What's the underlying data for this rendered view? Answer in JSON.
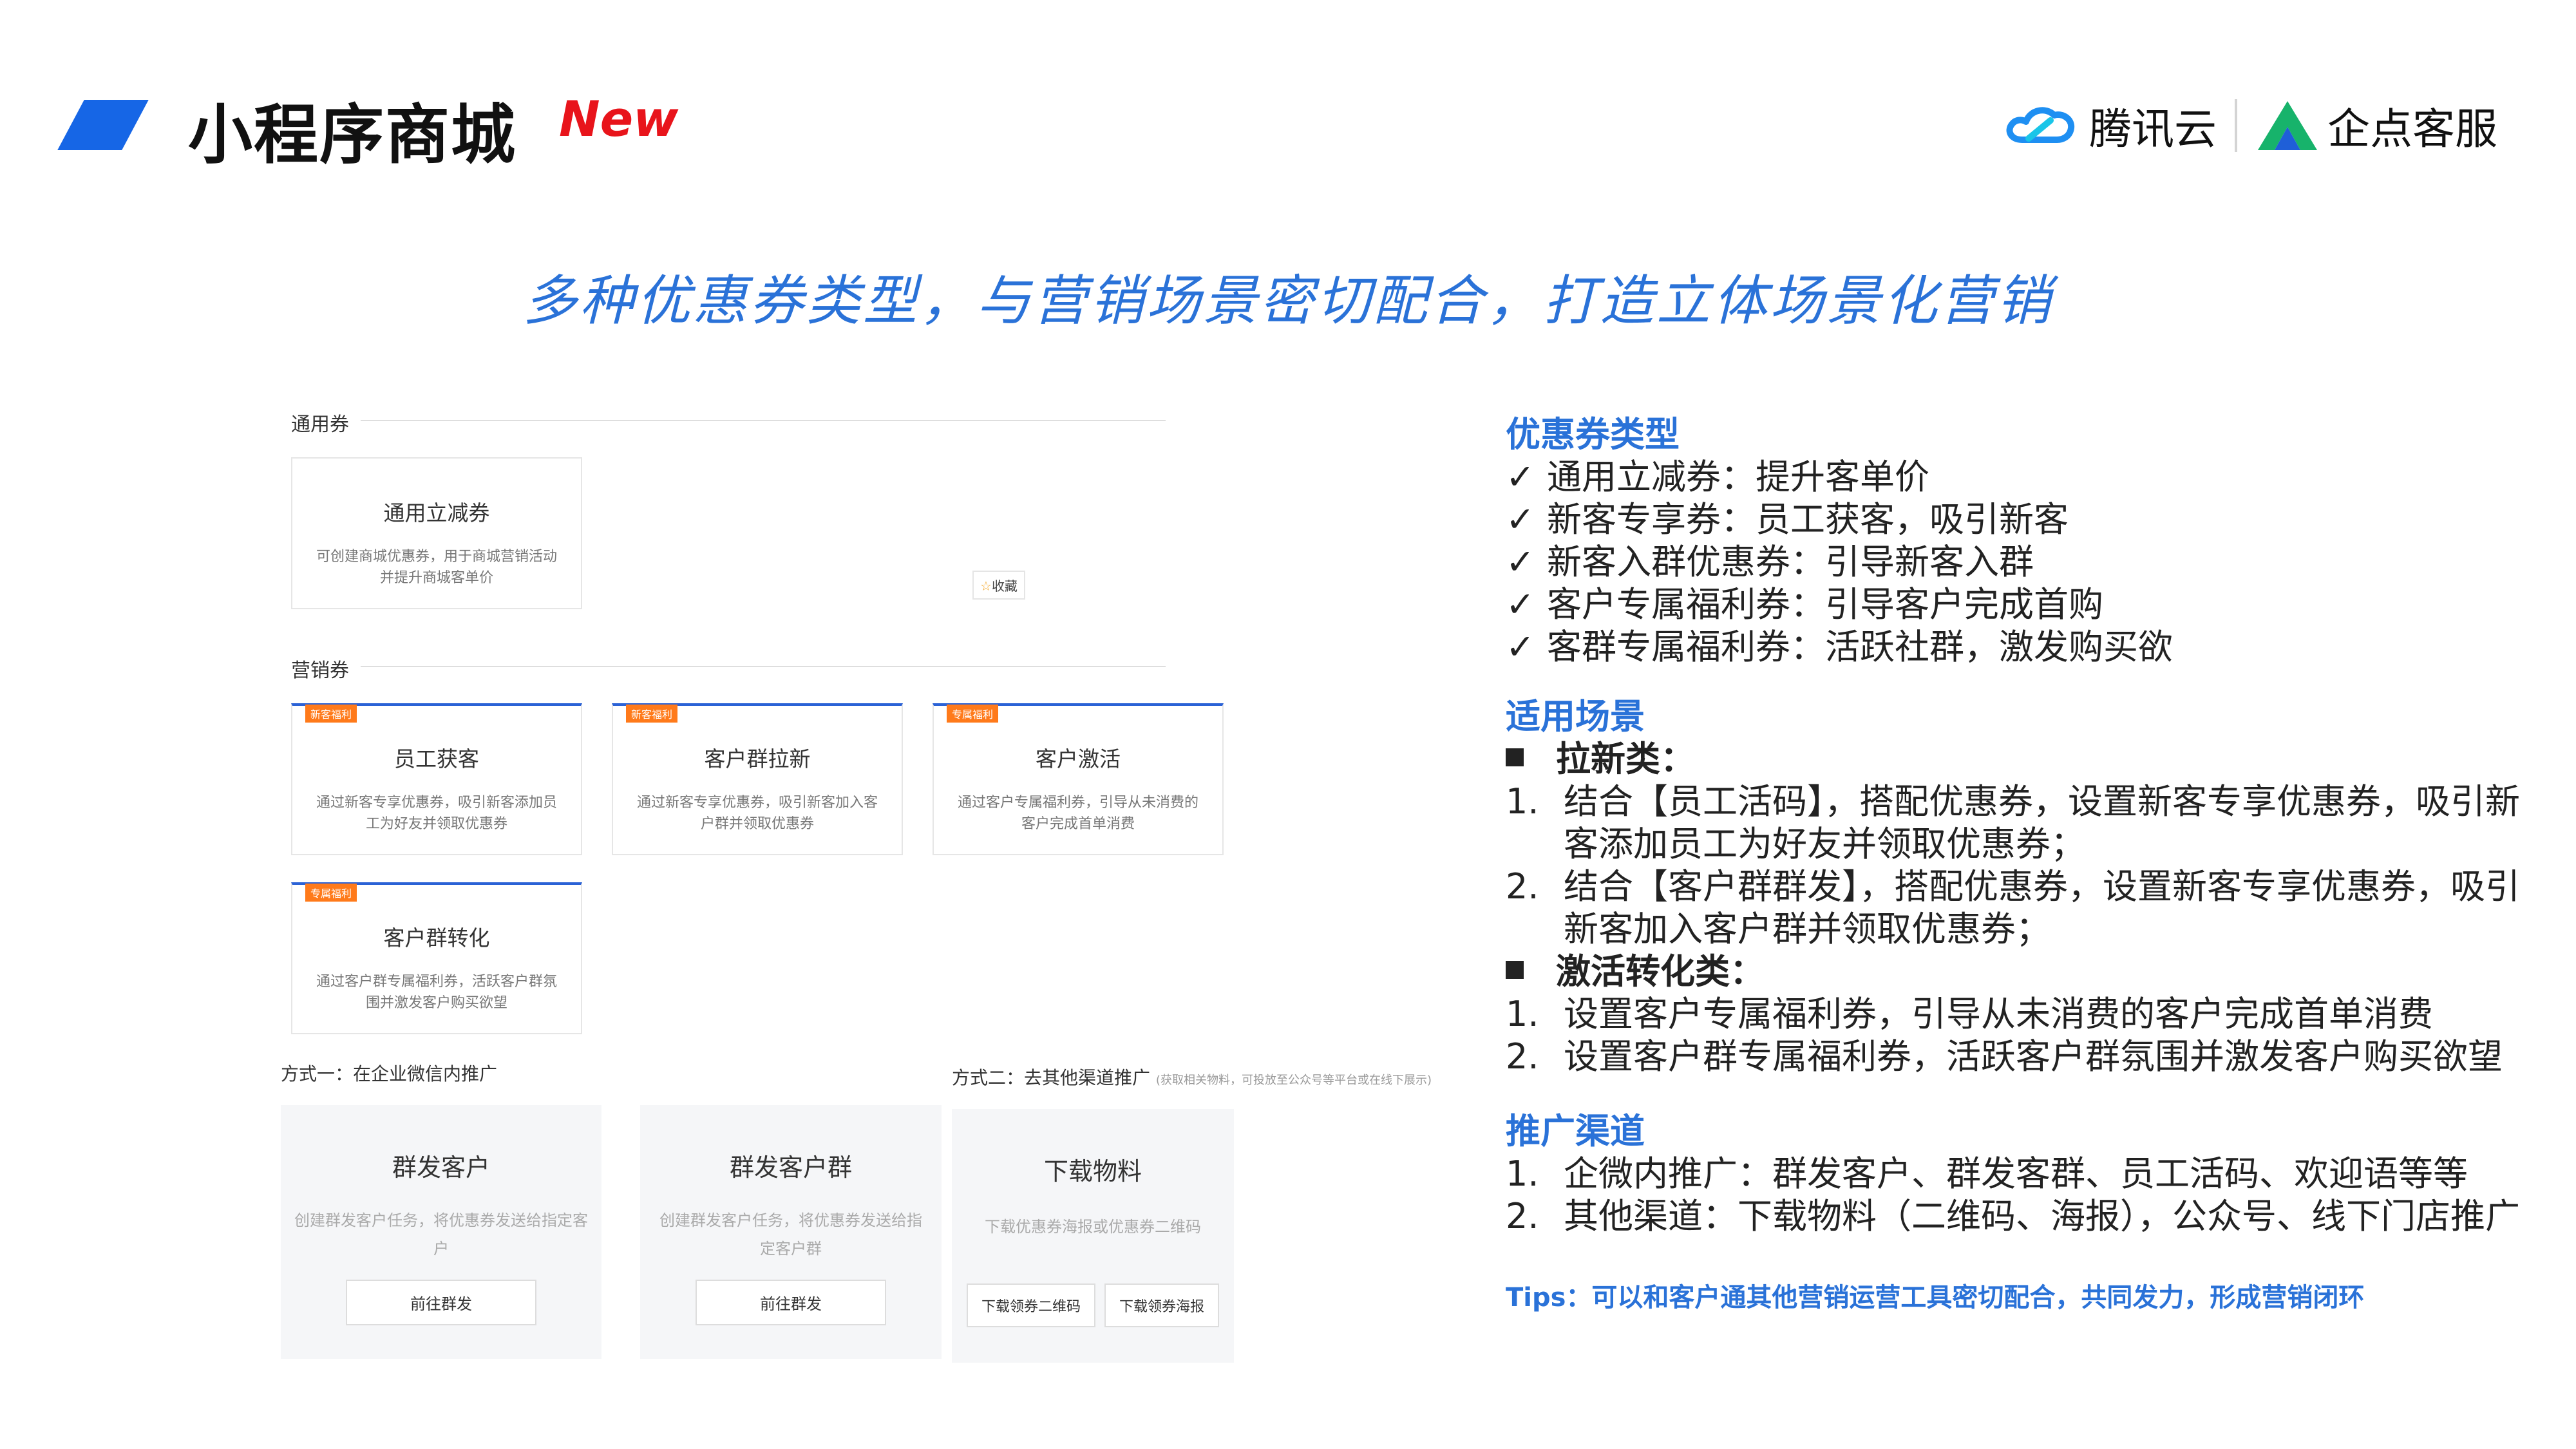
{
  "header": {
    "title": "小程序商城",
    "badge": "New",
    "logo_tencent": "腾讯云",
    "logo_qidian": "企点客服",
    "colors": {
      "brand": "#1666e6",
      "badge": "#e8141b",
      "accent": "#2a72d8"
    }
  },
  "subtitle": "多种优惠券类型，与营销场景密切配合，打造立体场景化营销",
  "ui": {
    "general_section": "通用券",
    "general_card": {
      "title": "通用立减券",
      "desc": "可创建商城优惠券，用于商城营销活动并提升商城客单价"
    },
    "favorite": "收藏",
    "marketing_section": "营销券",
    "marketing_cards": [
      {
        "tag": "新客福利",
        "title": "员工获客",
        "desc": "通过新客专享优惠券，吸引新客添加员工为好友并领取优惠券"
      },
      {
        "tag": "新客福利",
        "title": "客户群拉新",
        "desc": "通过新客专享优惠券，吸引新客加入客户群并领取优惠券"
      },
      {
        "tag": "专属福利",
        "title": "客户激活",
        "desc": "通过客户专属福利券，引导从未消费的客户完成首单消费"
      },
      {
        "tag": "专属福利",
        "title": "客户群转化",
        "desc": "通过客户群专属福利券，活跃客户群氛围并激发客户购买欲望"
      }
    ],
    "method1": "方式一：在企业微信内推广",
    "method2": "方式二：去其他渠道推广",
    "method2_note": "(获取相关物料，可投放至公众号等平台或在线下展示)",
    "promo_cards": [
      {
        "title": "群发客户",
        "desc": "创建群发客户任务，将优惠券发送给指定客户",
        "button": "前往群发"
      },
      {
        "title": "群发客户群",
        "desc": "创建群发客户任务，将优惠券发送给指定客户群",
        "button": "前往群发"
      },
      {
        "title": "下载物料",
        "desc": "下载优惠券海报或优惠券二维码",
        "button_qr": "下载领券二维码",
        "button_poster": "下载领券海报"
      }
    ]
  },
  "right": {
    "coupon_heading": "优惠券类型",
    "coupon_items": [
      "通用立减券：提升客单价",
      "新客专享券：员工获客，吸引新客",
      "新客入群优惠券：引导新客入群",
      "客户专属福利券：引导客户完成首购",
      "客群专属福利券：活跃社群，激发购买欲"
    ],
    "check_mark": "✓",
    "scene_heading": "适用场景",
    "cat1": "拉新类：",
    "cat1_items": [
      {
        "num": "1.",
        "l1": "结合【员工活码】，搭配优惠券，设置新客专享优惠券，吸引新",
        "l2": "客添加员工为好友并领取优惠券；"
      },
      {
        "num": "2.",
        "l1": "结合【客户群群发】，搭配优惠券，设置新客专享优惠券，吸引",
        "l2": "新客加入客户群并领取优惠券；"
      }
    ],
    "cat2": "激活转化类：",
    "cat2_items": [
      {
        "num": "1.",
        "text": "设置客户专属福利券，引导从未消费的客户完成首单消费"
      },
      {
        "num": "2.",
        "text": "设置客户群专属福利券，活跃客户群氛围并激发客户购买欲望"
      }
    ],
    "channel_heading": "推广渠道",
    "channel_items": [
      {
        "num": "1.",
        "text": "企微内推广：群发客户、群发客群、员工活码、欢迎语等等"
      },
      {
        "num": "2.",
        "text": "其他渠道：下载物料（二维码、海报），公众号、线下门店推广"
      }
    ],
    "tips": "Tips：可以和客户通其他营销运营工具密切配合，共同发力，形成营销闭环"
  }
}
